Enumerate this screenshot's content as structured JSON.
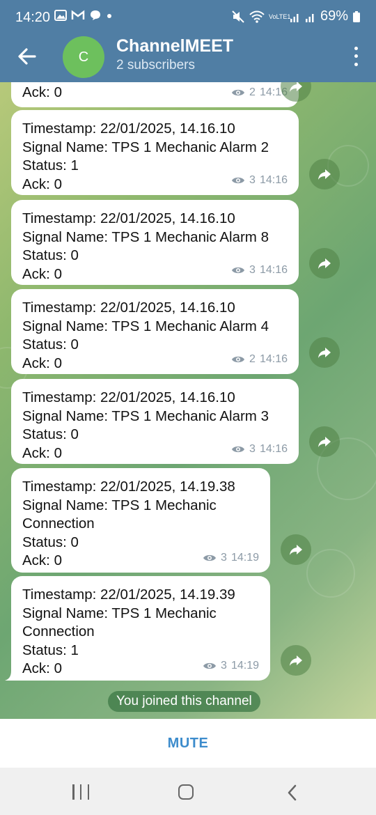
{
  "status_bar": {
    "time": "14:20",
    "battery": "69%",
    "network_label": "VoLTE1"
  },
  "header": {
    "avatar_letter": "C",
    "title": "ChannelMEET",
    "subtitle": "2 subscribers",
    "accent_color": "#507ea4"
  },
  "messages": [
    {
      "lines": [
        "Ack: 0"
      ],
      "views": "2",
      "time": "14:16"
    },
    {
      "lines": [
        "Timestamp: 22/01/2025, 14.16.10",
        "Signal Name: TPS 1 Mechanic Alarm 2",
        "Status: 1",
        "Ack: 0"
      ],
      "views": "3",
      "time": "14:16"
    },
    {
      "lines": [
        "Timestamp: 22/01/2025, 14.16.10",
        "Signal Name: TPS 1 Mechanic Alarm 8",
        "Status: 0",
        "Ack: 0"
      ],
      "views": "3",
      "time": "14:16"
    },
    {
      "lines": [
        "Timestamp: 22/01/2025, 14.16.10",
        "Signal Name: TPS 1 Mechanic Alarm 4",
        "Status: 0",
        "Ack: 0"
      ],
      "views": "2",
      "time": "14:16"
    },
    {
      "lines": [
        "Timestamp: 22/01/2025, 14.16.10",
        "Signal Name: TPS 1 Mechanic Alarm 3",
        "Status: 0",
        "Ack: 0"
      ],
      "views": "3",
      "time": "14:16"
    },
    {
      "lines": [
        "Timestamp: 22/01/2025, 14.19.38",
        "Signal Name: TPS 1 Mechanic",
        "Connection",
        "Status: 0",
        "Ack: 0"
      ],
      "views": "3",
      "time": "14:19"
    },
    {
      "lines": [
        "Timestamp: 22/01/2025, 14.19.39",
        "Signal Name: TPS 1 Mechanic",
        "Connection",
        "Status: 1",
        "Ack: 0"
      ],
      "views": "3",
      "time": "14:19"
    }
  ],
  "service_message": "You joined this channel",
  "bottom_bar": {
    "mute_label": "MUTE"
  }
}
